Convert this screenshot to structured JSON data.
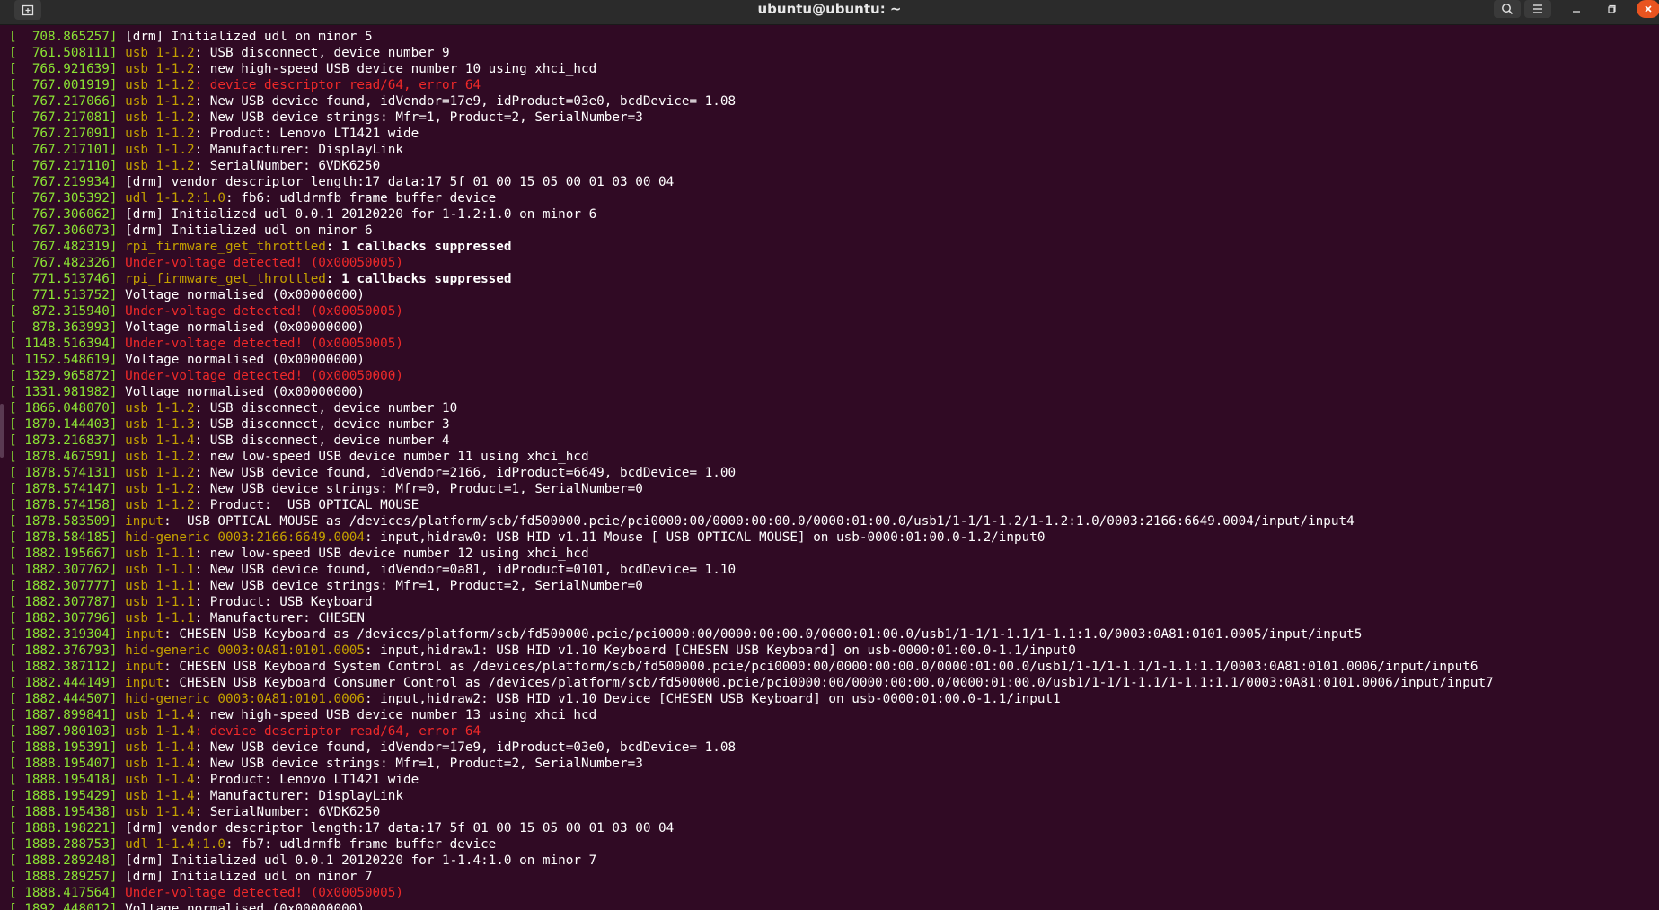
{
  "window": {
    "title": "ubuntu@ubuntu: ~",
    "icons": {
      "new_tab": "new-tab-icon",
      "search": "search-icon",
      "menu": "hamburger-menu-icon",
      "minimize": "minimize-icon",
      "maximize": "maximize-icon",
      "close": "close-icon"
    }
  },
  "colors": {
    "background": "#300a24",
    "timestamp": "#8ae234",
    "device": "#c4a000",
    "error": "#ef2929",
    "text": "#ffffff",
    "close_button": "#e95420"
  },
  "terminal": {
    "lines": [
      {
        "ts": "[  708.865257]",
        "dev": "",
        "msg": " [drm] Initialized udl on minor 5",
        "style": "normal"
      },
      {
        "ts": "[  761.508111]",
        "dev": " usb 1-1.2",
        "msg": ": USB disconnect, device number 9",
        "style": "normal"
      },
      {
        "ts": "[  766.921639]",
        "dev": " usb 1-1.2",
        "msg": ": new high-speed USB device number 10 using xhci_hcd",
        "style": "normal"
      },
      {
        "ts": "[  767.001919]",
        "dev": " usb 1-1.2",
        "msg": ": device descriptor read/64, error 64",
        "style": "error"
      },
      {
        "ts": "[  767.217066]",
        "dev": " usb 1-1.2",
        "msg": ": New USB device found, idVendor=17e9, idProduct=03e0, bcdDevice= 1.08",
        "style": "normal"
      },
      {
        "ts": "[  767.217081]",
        "dev": " usb 1-1.2",
        "msg": ": New USB device strings: Mfr=1, Product=2, SerialNumber=3",
        "style": "normal"
      },
      {
        "ts": "[  767.217091]",
        "dev": " usb 1-1.2",
        "msg": ": Product: Lenovo LT1421 wide",
        "style": "normal"
      },
      {
        "ts": "[  767.217101]",
        "dev": " usb 1-1.2",
        "msg": ": Manufacturer: DisplayLink",
        "style": "normal"
      },
      {
        "ts": "[  767.217110]",
        "dev": " usb 1-1.2",
        "msg": ": SerialNumber: 6VDK6250",
        "style": "normal"
      },
      {
        "ts": "[  767.219934]",
        "dev": "",
        "msg": " [drm] vendor descriptor length:17 data:17 5f 01 00 15 05 00 01 03 00 04",
        "style": "normal"
      },
      {
        "ts": "[  767.305392]",
        "dev": " udl 1-1.2:1.0",
        "msg": ": fb6: udldrmfb frame buffer device",
        "style": "normal"
      },
      {
        "ts": "[  767.306062]",
        "dev": "",
        "msg": " [drm] Initialized udl 0.0.1 20120220 for 1-1.2:1.0 on minor 6",
        "style": "normal"
      },
      {
        "ts": "[  767.306073]",
        "dev": "",
        "msg": " [drm] Initialized udl on minor 6",
        "style": "normal"
      },
      {
        "ts": "[  767.482319]",
        "dev": " rpi_firmware_get_throttled",
        "msg": ": 1 callbacks suppressed",
        "style": "bold"
      },
      {
        "ts": "[  767.482326]",
        "dev": "",
        "msg": " Under-voltage detected! (0x00050005)",
        "style": "error"
      },
      {
        "ts": "[  771.513746]",
        "dev": " rpi_firmware_get_throttled",
        "msg": ": 1 callbacks suppressed",
        "style": "bold"
      },
      {
        "ts": "[  771.513752]",
        "dev": "",
        "msg": " Voltage normalised (0x00000000)",
        "style": "normal"
      },
      {
        "ts": "[  872.315940]",
        "dev": "",
        "msg": " Under-voltage detected! (0x00050005)",
        "style": "error"
      },
      {
        "ts": "[  878.363993]",
        "dev": "",
        "msg": " Voltage normalised (0x00000000)",
        "style": "normal"
      },
      {
        "ts": "[ 1148.516394]",
        "dev": "",
        "msg": " Under-voltage detected! (0x00050005)",
        "style": "error"
      },
      {
        "ts": "[ 1152.548619]",
        "dev": "",
        "msg": " Voltage normalised (0x00000000)",
        "style": "normal"
      },
      {
        "ts": "[ 1329.965872]",
        "dev": "",
        "msg": " Under-voltage detected! (0x00050000)",
        "style": "error"
      },
      {
        "ts": "[ 1331.981982]",
        "dev": "",
        "msg": " Voltage normalised (0x00000000)",
        "style": "normal"
      },
      {
        "ts": "[ 1866.048070]",
        "dev": " usb 1-1.2",
        "msg": ": USB disconnect, device number 10",
        "style": "normal"
      },
      {
        "ts": "[ 1870.144403]",
        "dev": " usb 1-1.3",
        "msg": ": USB disconnect, device number 3",
        "style": "normal"
      },
      {
        "ts": "[ 1873.216837]",
        "dev": " usb 1-1.4",
        "msg": ": USB disconnect, device number 4",
        "style": "normal"
      },
      {
        "ts": "[ 1878.467591]",
        "dev": " usb 1-1.2",
        "msg": ": new low-speed USB device number 11 using xhci_hcd",
        "style": "normal"
      },
      {
        "ts": "[ 1878.574131]",
        "dev": " usb 1-1.2",
        "msg": ": New USB device found, idVendor=2166, idProduct=6649, bcdDevice= 1.00",
        "style": "normal"
      },
      {
        "ts": "[ 1878.574147]",
        "dev": " usb 1-1.2",
        "msg": ": New USB device strings: Mfr=0, Product=1, SerialNumber=0",
        "style": "normal"
      },
      {
        "ts": "[ 1878.574158]",
        "dev": " usb 1-1.2",
        "msg": ": Product:  USB OPTICAL MOUSE",
        "style": "normal"
      },
      {
        "ts": "[ 1878.583509]",
        "dev": " input",
        "msg": ":  USB OPTICAL MOUSE as /devices/platform/scb/fd500000.pcie/pci0000:00/0000:00:00.0/0000:01:00.0/usb1/1-1/1-1.2/1-1.2:1.0/0003:2166:6649.0004/input/input4",
        "style": "normal"
      },
      {
        "ts": "[ 1878.584185]",
        "dev": " hid-generic 0003:2166:6649.0004",
        "msg": ": input,hidraw0: USB HID v1.11 Mouse [ USB OPTICAL MOUSE] on usb-0000:01:00.0-1.2/input0",
        "style": "normal"
      },
      {
        "ts": "[ 1882.195667]",
        "dev": " usb 1-1.1",
        "msg": ": new low-speed USB device number 12 using xhci_hcd",
        "style": "normal"
      },
      {
        "ts": "[ 1882.307762]",
        "dev": " usb 1-1.1",
        "msg": ": New USB device found, idVendor=0a81, idProduct=0101, bcdDevice= 1.10",
        "style": "normal"
      },
      {
        "ts": "[ 1882.307777]",
        "dev": " usb 1-1.1",
        "msg": ": New USB device strings: Mfr=1, Product=2, SerialNumber=0",
        "style": "normal"
      },
      {
        "ts": "[ 1882.307787]",
        "dev": " usb 1-1.1",
        "msg": ": Product: USB Keyboard",
        "style": "normal"
      },
      {
        "ts": "[ 1882.307796]",
        "dev": " usb 1-1.1",
        "msg": ": Manufacturer: CHESEN",
        "style": "normal"
      },
      {
        "ts": "[ 1882.319304]",
        "dev": " input",
        "msg": ": CHESEN USB Keyboard as /devices/platform/scb/fd500000.pcie/pci0000:00/0000:00:00.0/0000:01:00.0/usb1/1-1/1-1.1/1-1.1:1.0/0003:0A81:0101.0005/input/input5",
        "style": "normal"
      },
      {
        "ts": "[ 1882.376793]",
        "dev": " hid-generic 0003:0A81:0101.0005",
        "msg": ": input,hidraw1: USB HID v1.10 Keyboard [CHESEN USB Keyboard] on usb-0000:01:00.0-1.1/input0",
        "style": "normal"
      },
      {
        "ts": "[ 1882.387112]",
        "dev": " input",
        "msg": ": CHESEN USB Keyboard System Control as /devices/platform/scb/fd500000.pcie/pci0000:00/0000:00:00.0/0000:01:00.0/usb1/1-1/1-1.1/1-1.1:1.1/0003:0A81:0101.0006/input/input6",
        "style": "normal"
      },
      {
        "ts": "[ 1882.444149]",
        "dev": " input",
        "msg": ": CHESEN USB Keyboard Consumer Control as /devices/platform/scb/fd500000.pcie/pci0000:00/0000:00:00.0/0000:01:00.0/usb1/1-1/1-1.1/1-1.1:1.1/0003:0A81:0101.0006/input/input7",
        "style": "normal"
      },
      {
        "ts": "[ 1882.444507]",
        "dev": " hid-generic 0003:0A81:0101.0006",
        "msg": ": input,hidraw2: USB HID v1.10 Device [CHESEN USB Keyboard] on usb-0000:01:00.0-1.1/input1",
        "style": "normal"
      },
      {
        "ts": "[ 1887.899841]",
        "dev": " usb 1-1.4",
        "msg": ": new high-speed USB device number 13 using xhci_hcd",
        "style": "normal"
      },
      {
        "ts": "[ 1887.980103]",
        "dev": " usb 1-1.4",
        "msg": ": device descriptor read/64, error 64",
        "style": "error"
      },
      {
        "ts": "[ 1888.195391]",
        "dev": " usb 1-1.4",
        "msg": ": New USB device found, idVendor=17e9, idProduct=03e0, bcdDevice= 1.08",
        "style": "normal"
      },
      {
        "ts": "[ 1888.195407]",
        "dev": " usb 1-1.4",
        "msg": ": New USB device strings: Mfr=1, Product=2, SerialNumber=3",
        "style": "normal"
      },
      {
        "ts": "[ 1888.195418]",
        "dev": " usb 1-1.4",
        "msg": ": Product: Lenovo LT1421 wide",
        "style": "normal"
      },
      {
        "ts": "[ 1888.195429]",
        "dev": " usb 1-1.4",
        "msg": ": Manufacturer: DisplayLink",
        "style": "normal"
      },
      {
        "ts": "[ 1888.195438]",
        "dev": " usb 1-1.4",
        "msg": ": SerialNumber: 6VDK6250",
        "style": "normal"
      },
      {
        "ts": "[ 1888.198221]",
        "dev": "",
        "msg": " [drm] vendor descriptor length:17 data:17 5f 01 00 15 05 00 01 03 00 04",
        "style": "normal"
      },
      {
        "ts": "[ 1888.288753]",
        "dev": " udl 1-1.4:1.0",
        "msg": ": fb7: udldrmfb frame buffer device",
        "style": "normal"
      },
      {
        "ts": "[ 1888.289248]",
        "dev": "",
        "msg": " [drm] Initialized udl 0.0.1 20120220 for 1-1.4:1.0 on minor 7",
        "style": "normal"
      },
      {
        "ts": "[ 1888.289257]",
        "dev": "",
        "msg": " [drm] Initialized udl on minor 7",
        "style": "normal"
      },
      {
        "ts": "[ 1888.417564]",
        "dev": "",
        "msg": " Under-voltage detected! (0x00050005)",
        "style": "error"
      },
      {
        "ts": "[ 1892.448012]",
        "dev": "",
        "msg": " Voltage normalised (0x00000000)",
        "style": "normal"
      }
    ]
  }
}
